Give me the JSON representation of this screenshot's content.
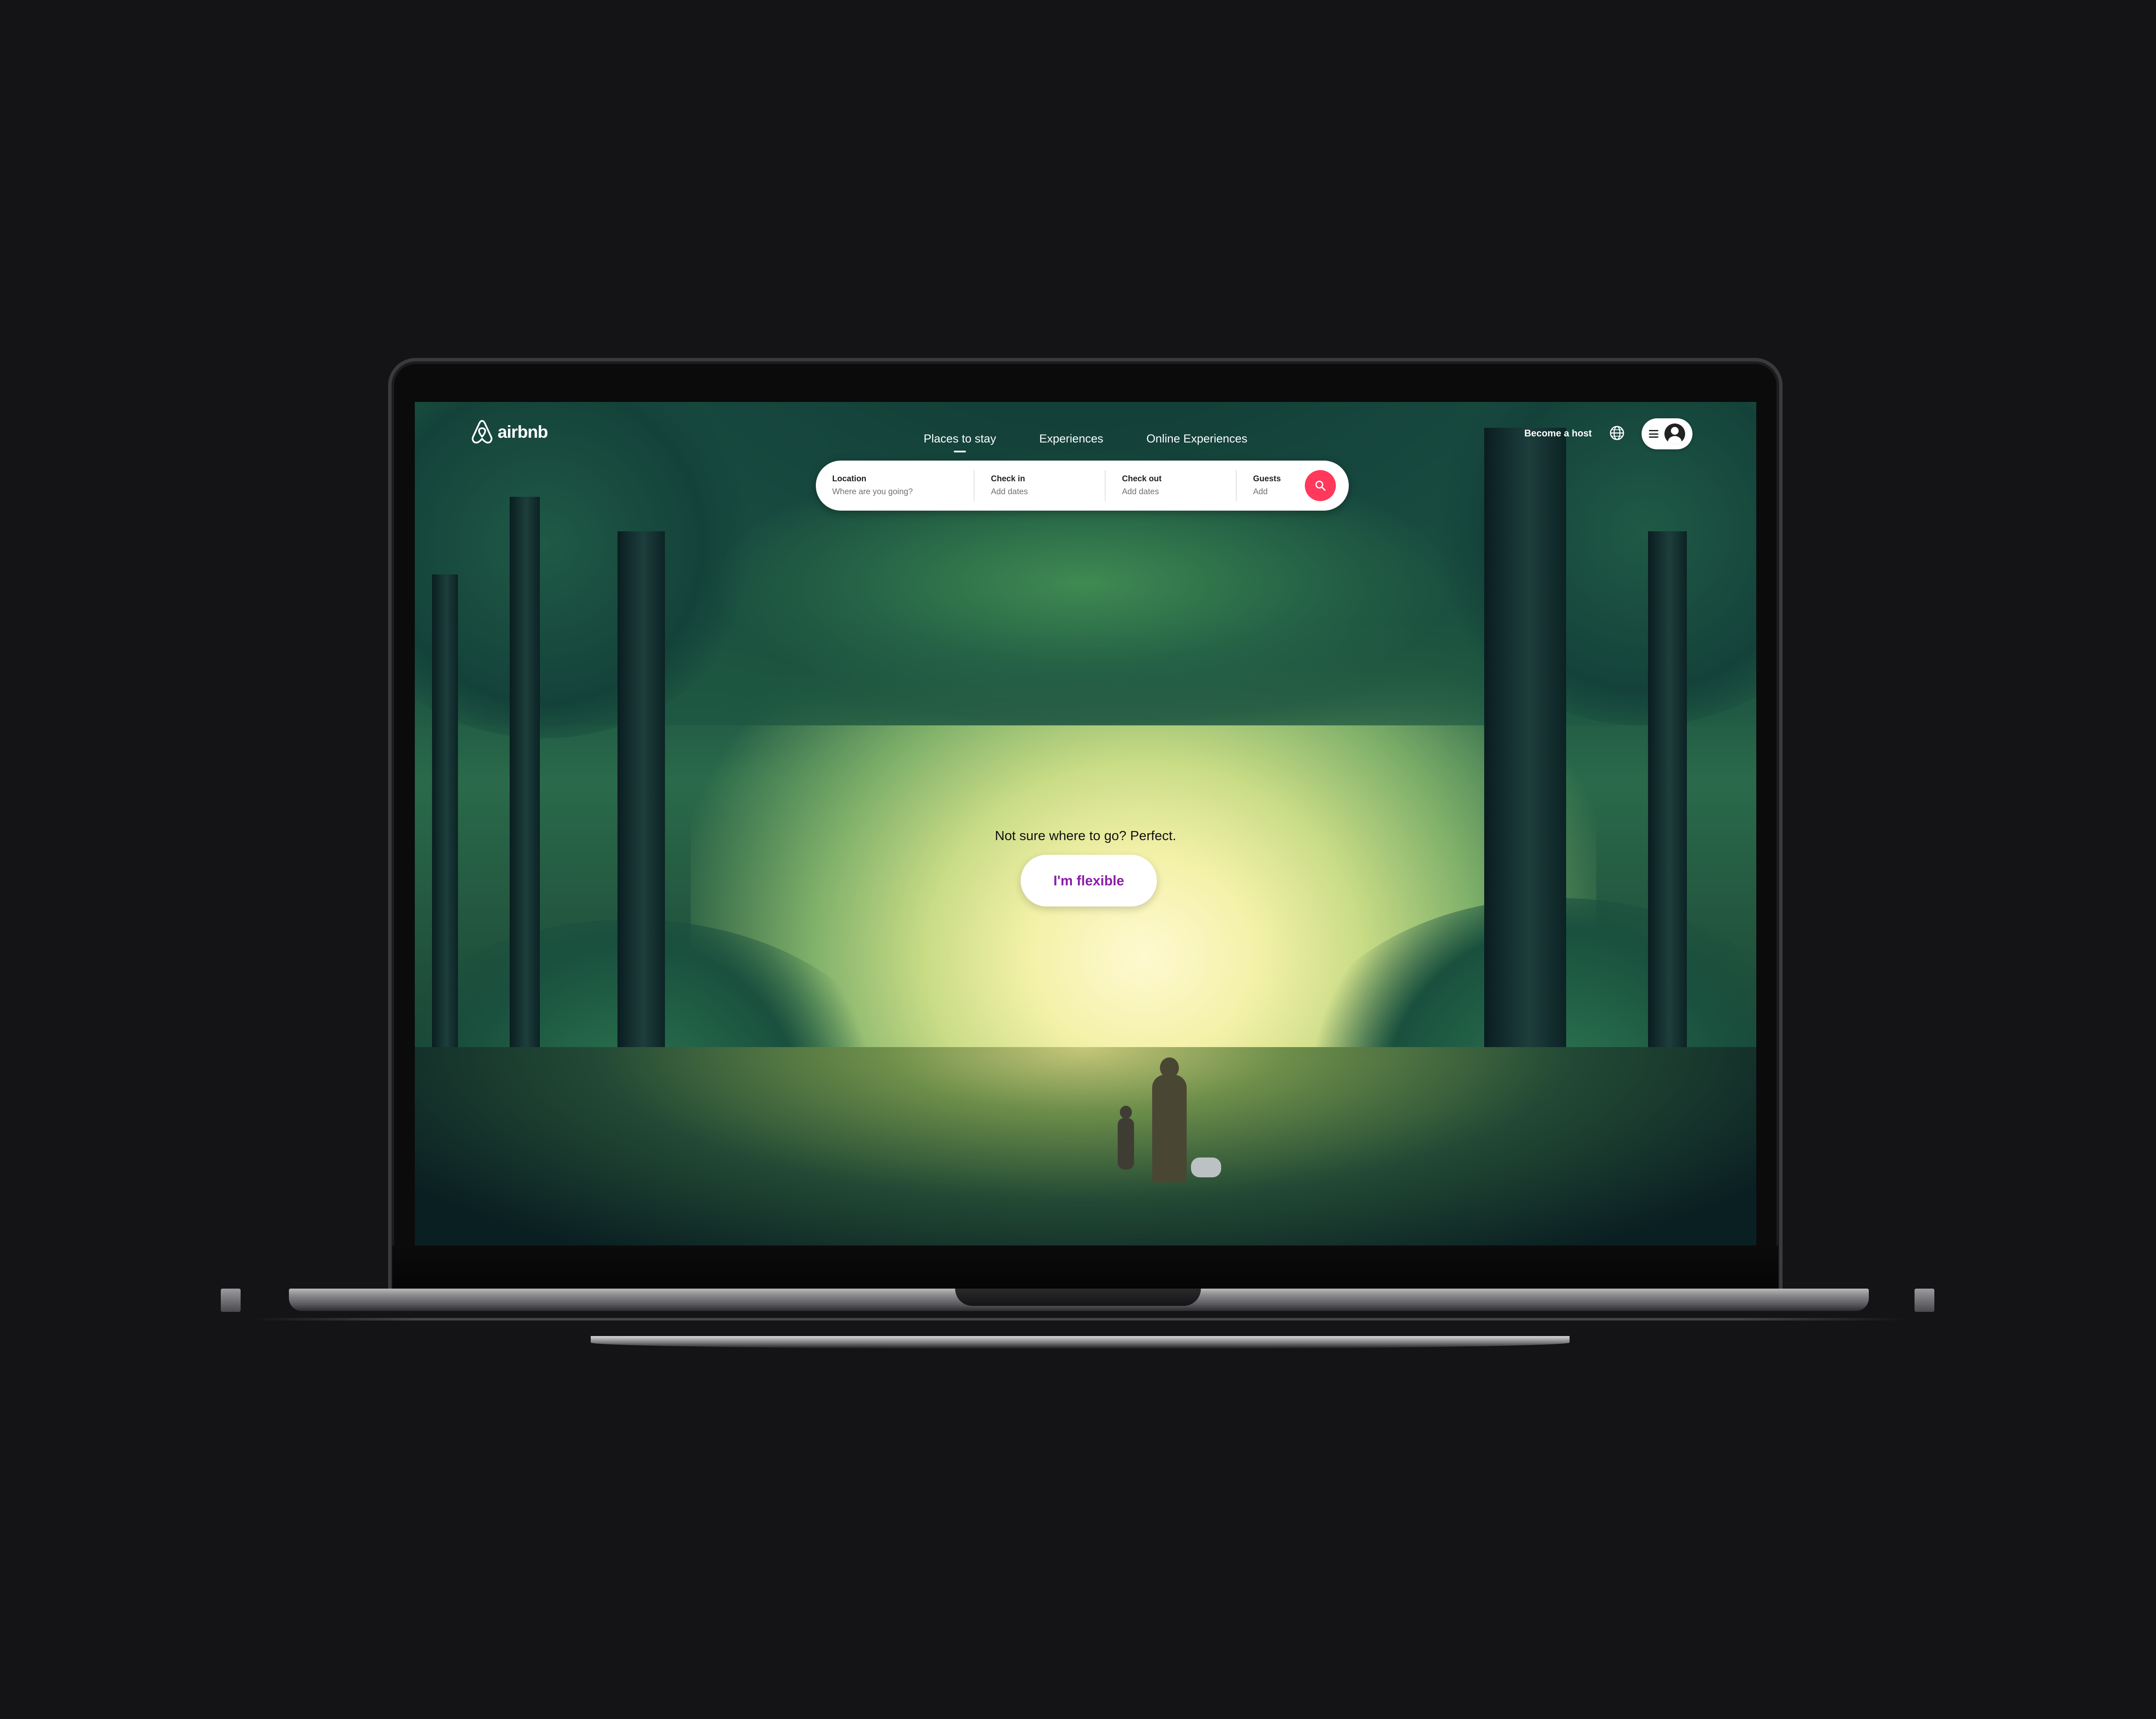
{
  "brand": {
    "name": "airbnb",
    "color": "#ff385c"
  },
  "nav": {
    "items": [
      {
        "label": "Places to stay",
        "active": true
      },
      {
        "label": "Experiences",
        "active": false
      },
      {
        "label": "Online Experiences",
        "active": false
      }
    ]
  },
  "header": {
    "host_label": "Become a host",
    "globe_icon": "globe-icon",
    "menu_icon": "hamburger-icon",
    "avatar_icon": "user-avatar-icon"
  },
  "search": {
    "fields": [
      {
        "label": "Location",
        "value": "Where are you going?"
      },
      {
        "label": "Check in",
        "value": "Add dates"
      },
      {
        "label": "Check out",
        "value": "Add dates"
      },
      {
        "label": "Guests",
        "value": "Add"
      }
    ],
    "button_icon": "search-icon"
  },
  "hero": {
    "tagline": "Not sure where to go? Perfect.",
    "cta_label": "I'm flexible",
    "cta_color": "#8a1fa8"
  }
}
